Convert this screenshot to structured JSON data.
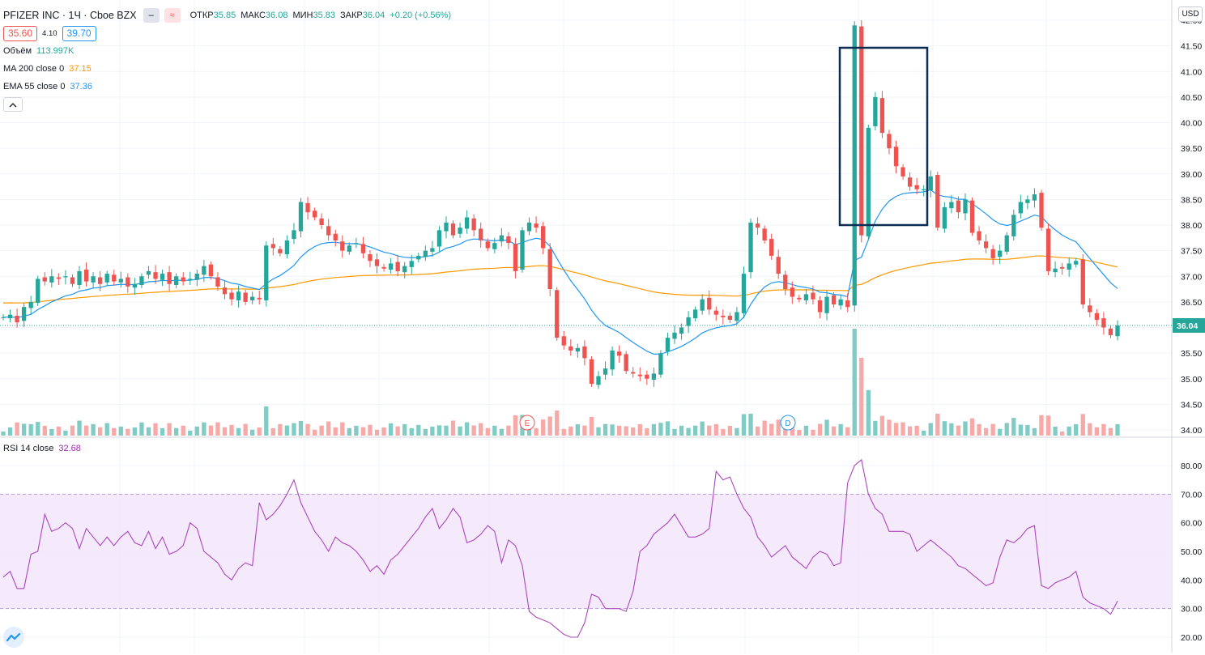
{
  "symbol": {
    "name": "PFIZER INC",
    "separator": " · ",
    "interval": "1Ч",
    "exchange": "Cboe BZX",
    "title": "PFIZER INC · 1Ч · Cboe BZX"
  },
  "ohlc": {
    "open_label": "ОТКР",
    "open": "35.85",
    "high_label": "МАКС",
    "high": "36.08",
    "low_label": "МИН",
    "low": "35.83",
    "close_label": "ЗАКР",
    "close": "36.04",
    "change": "+0.20 (+0.56%)"
  },
  "trade": {
    "sell": "35.60",
    "spread": "4.10",
    "buy": "39.70"
  },
  "indicators": {
    "volume": {
      "label": "Объём",
      "value": "113.997K",
      "color": "#26a69a"
    },
    "ma200": {
      "label": "MA 200 close 0",
      "value": "37.15",
      "color": "#ff9800"
    },
    "ema55": {
      "label": "EMA 55 close 0",
      "value": "37.36",
      "color": "#2196f3"
    }
  },
  "collapse_icon": "chevron-up-icon",
  "currency_button": "USD",
  "last_price_label": "36.04",
  "event_markers": [
    "E",
    "D"
  ],
  "rsi": {
    "label": "RSI 14 close",
    "value": "32.68",
    "color": "#9c27b0",
    "band_upper": 70,
    "band_lower": 30
  },
  "colors": {
    "up": "#26a69a",
    "down": "#ef5350",
    "ma200": "#ff9800",
    "ema55": "#2196f3",
    "rsi": "#ab47bc",
    "highlight_box": "#0d2c54"
  },
  "chart_data": [
    {
      "type": "candlestick",
      "title": "PFIZER INC · 1Ч · Cboe BZX",
      "ylim": [
        33.9,
        42.2
      ],
      "ytick_labels": [
        "34.00",
        "34.50",
        "35.00",
        "35.50",
        "36.00",
        "36.50",
        "37.00",
        "37.50",
        "38.00",
        "38.50",
        "39.00",
        "39.50",
        "40.00",
        "40.50",
        "41.00",
        "41.50",
        "42.00"
      ],
      "grid": true,
      "series": [
        {
          "name": "MA 200 close 0",
          "last": 37.15
        },
        {
          "name": "EMA 55 close 0",
          "last": 37.36
        }
      ],
      "closes": [
        36.2,
        36.25,
        36.1,
        36.4,
        36.5,
        36.95,
        36.9,
        37.0,
        36.95,
        37.0,
        36.85,
        37.1,
        36.9,
        37.0,
        36.85,
        37.05,
        36.9,
        36.95,
        36.8,
        36.85,
        37.0,
        37.1,
        36.95,
        37.05,
        36.85,
        37.0,
        36.9,
        36.95,
        37.05,
        37.2,
        37.0,
        36.8,
        36.65,
        36.55,
        36.7,
        36.5,
        36.6,
        36.55,
        37.6,
        37.55,
        37.45,
        37.7,
        37.9,
        38.45,
        38.25,
        38.15,
        38.0,
        37.8,
        37.7,
        37.5,
        37.6,
        37.65,
        37.45,
        37.3,
        37.2,
        37.15,
        37.25,
        37.1,
        37.2,
        37.3,
        37.4,
        37.5,
        37.55,
        37.9,
        38.05,
        37.8,
        37.95,
        38.15,
        37.9,
        37.7,
        37.55,
        37.65,
        37.8,
        37.65,
        37.1,
        37.9,
        38.05,
        37.95,
        37.55,
        36.75,
        35.8,
        35.65,
        35.55,
        35.6,
        35.4,
        34.9,
        35.05,
        35.2,
        35.55,
        35.45,
        35.15,
        35.1,
        35.05,
        35.0,
        35.1,
        35.5,
        35.8,
        35.9,
        36.0,
        36.2,
        36.35,
        36.55,
        36.35,
        36.25,
        36.2,
        36.15,
        36.3,
        37.05,
        38.05,
        37.95,
        37.7,
        37.4,
        37.05,
        36.75,
        36.6,
        36.55,
        36.65,
        36.55,
        36.3,
        36.6,
        36.45,
        36.55,
        36.4,
        41.9,
        37.8,
        39.9,
        40.5,
        39.8,
        39.5,
        39.15,
        38.95,
        38.75,
        38.7,
        38.7,
        38.95,
        37.95,
        38.35,
        38.45,
        38.25,
        38.5,
        37.85,
        37.7,
        37.55,
        37.35,
        37.5,
        37.8,
        38.2,
        38.45,
        38.5,
        38.6,
        37.95,
        37.1,
        37.15,
        37.15,
        37.25,
        37.3,
        36.45,
        36.3,
        36.15,
        36.0,
        35.85,
        36.04
      ],
      "last_close": 36.04,
      "highlighted_region": "spike to 41.9"
    },
    {
      "type": "bar",
      "title": "Объём",
      "last": "113.997K"
    },
    {
      "type": "line",
      "title": "RSI 14 close",
      "ylim": [
        18,
        86
      ],
      "ytick_labels": [
        "20.00",
        "30.00",
        "40.00",
        "50.00",
        "60.00",
        "70.00",
        "80.00"
      ],
      "bands": [
        30,
        70
      ],
      "values": [
        41,
        43,
        37,
        37,
        49,
        50,
        63,
        57,
        58,
        60,
        58,
        51,
        58,
        55,
        52,
        55,
        52,
        55,
        57,
        53,
        52,
        57,
        51,
        55,
        49,
        50,
        52,
        60,
        58,
        50,
        48,
        46,
        42,
        40,
        44,
        46,
        45,
        67,
        61,
        63,
        66,
        70,
        75,
        67,
        62,
        57,
        54,
        50,
        55,
        53,
        52,
        50,
        47,
        43,
        45,
        42,
        47,
        49,
        52,
        55,
        58,
        62,
        65,
        58,
        61,
        65,
        62,
        53,
        54,
        56,
        59,
        57,
        46,
        54,
        52,
        45,
        29,
        27,
        26,
        25,
        23,
        21,
        20,
        20,
        25,
        35,
        34,
        30,
        30,
        30,
        29,
        36,
        50,
        52,
        56,
        58,
        60,
        63,
        59,
        55,
        55,
        56,
        58,
        78,
        75,
        76,
        70,
        65,
        62,
        55,
        52,
        48,
        50,
        52,
        48,
        46,
        44,
        48,
        50,
        49,
        45,
        46,
        74,
        80,
        82,
        70,
        65,
        63,
        57,
        57,
        57,
        56,
        50,
        52,
        54,
        52,
        50,
        48,
        45,
        44,
        42,
        40,
        38,
        39,
        48,
        54,
        53,
        55,
        58,
        59,
        38,
        37,
        39,
        40,
        41,
        43,
        34,
        32,
        31,
        30,
        28,
        32.68
      ],
      "last": 32.68
    }
  ]
}
